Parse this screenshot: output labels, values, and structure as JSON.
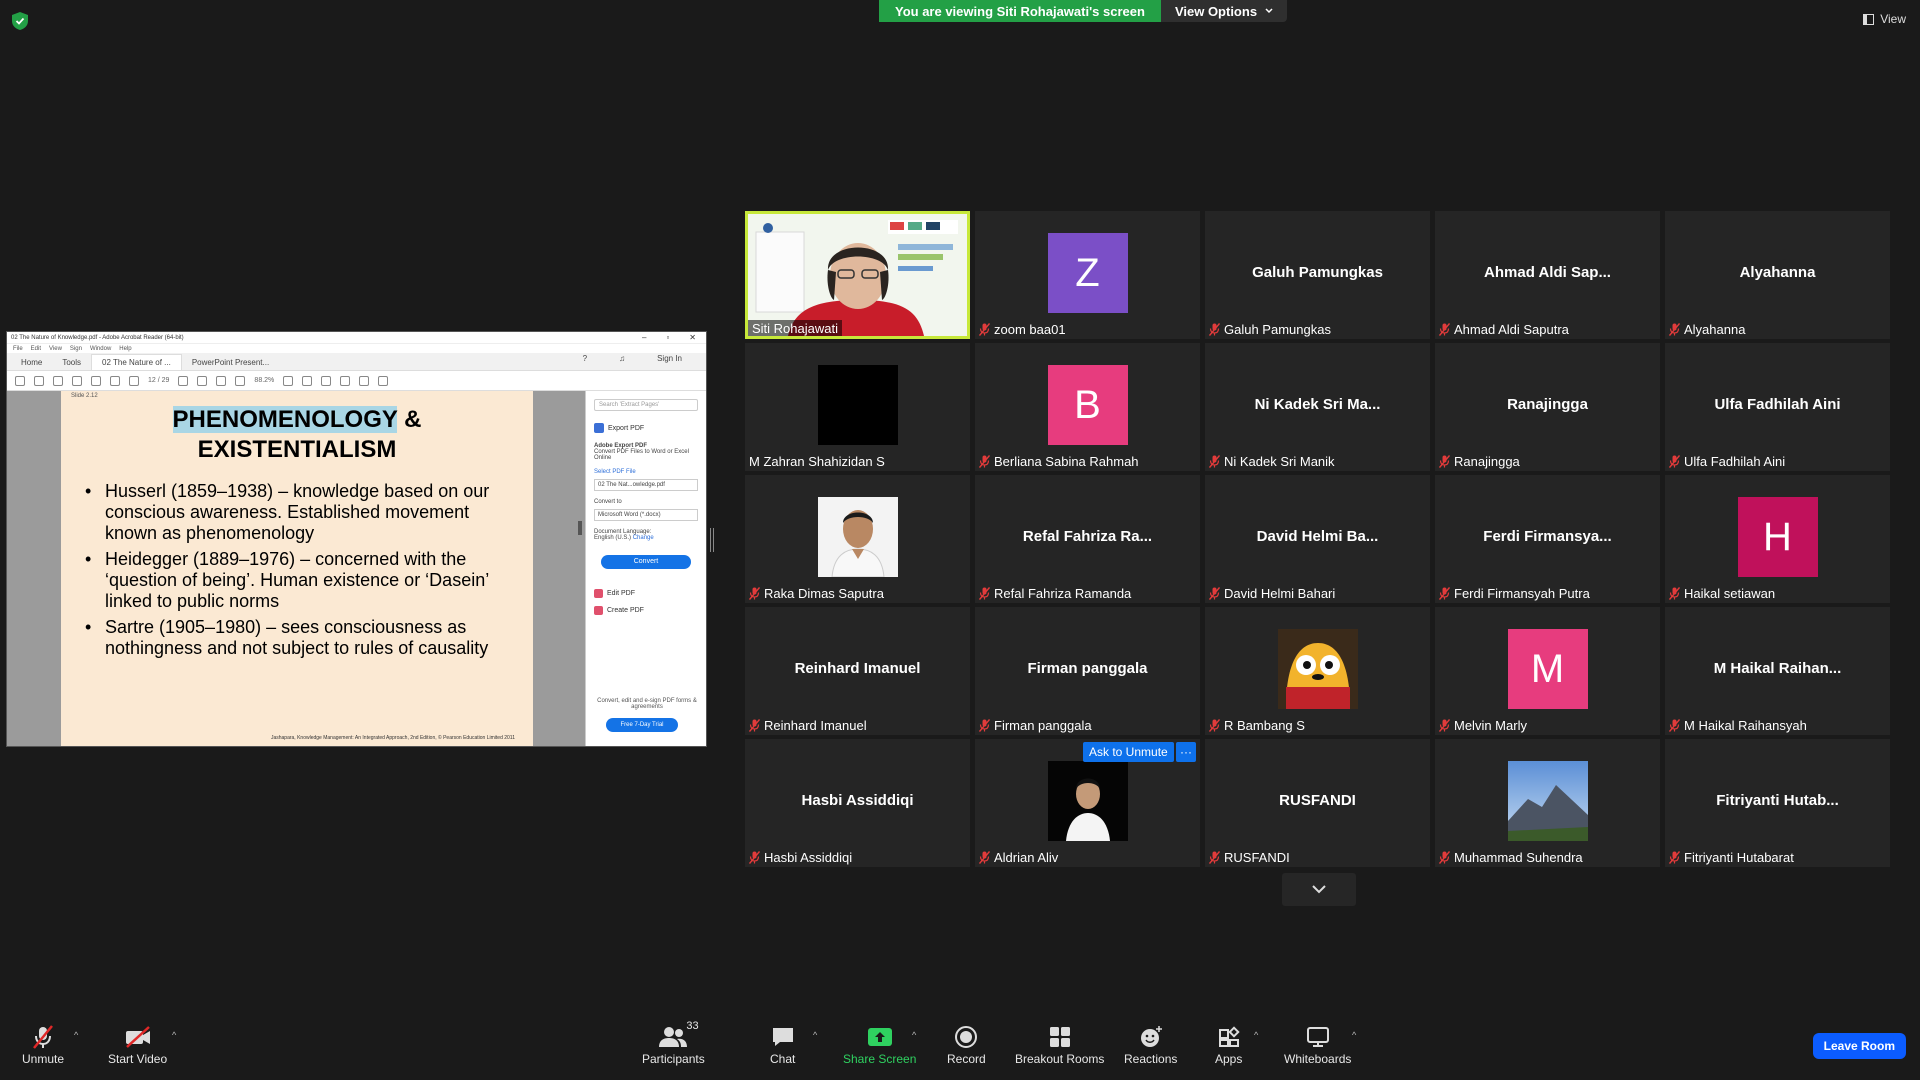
{
  "banner": {
    "viewing_text": "You are viewing Siti Rohajawati's screen",
    "view_options": "View Options",
    "view_label": "View"
  },
  "shared_screen": {
    "window_title": "02 The Nature of Knowledge.pdf - Adobe Acrobat Reader (64-bit)",
    "menu": [
      "File",
      "Edit",
      "View",
      "Sign",
      "Window",
      "Help"
    ],
    "tabs": [
      "Home",
      "Tools",
      "02 The Nature of ...",
      "PowerPoint Present..."
    ],
    "sign_in": "Sign In",
    "page_indicator": "12 / 29",
    "zoom": "88.2%",
    "slide_label": "Slide 2.12",
    "slide_title_highlight": "PHENOMENOLOGY",
    "slide_title_rest": " &",
    "slide_title_line2": "EXISTENTIALISM",
    "bullets": [
      "Husserl (1859–1938) – knowledge based on our conscious awareness. Established movement known as phenomenology",
      "Heidegger (1889–1976) – concerned with the ‘question of being’. Human existence or ‘Dasein’ linked to public norms",
      "Sartre (1905–1980) – sees consciousness as nothingness and not subject to rules of causality"
    ],
    "slide_footer": "Jashapara, Knowledge Management: An Integrated Approach, 2nd Edition, © Pearson Education Limited 2011",
    "panel": {
      "search_placeholder": "Search 'Extract Pages'",
      "export_label": "Export PDF",
      "adobe_export": "Adobe Export PDF",
      "convert_desc": "Convert PDF Files to Word or Excel Online",
      "select_file": "Select PDF File",
      "file_name": "02 The Nat...owledge.pdf",
      "convert_to": "Convert to",
      "convert_format": "Microsoft Word (*.docx)",
      "doc_language": "Document Language:",
      "language": "English (U.S.)",
      "change": "Change",
      "convert_btn": "Convert",
      "edit_pdf": "Edit PDF",
      "create_pdf": "Create PDF",
      "note": "Convert, edit and e-sign PDF forms & agreements",
      "trial_btn": "Free 7-Day Trial"
    }
  },
  "participants_tiles": [
    {
      "big": "",
      "label": "Siti Rohajawati",
      "type": "video-presenter",
      "muted": false,
      "speaking": true
    },
    {
      "big": "Z",
      "label": "zoom baa01",
      "type": "avatar",
      "color": "#7b4fc7",
      "muted": true
    },
    {
      "big": "Galuh Pamungkas",
      "label": "Galuh Pamungkas",
      "type": "name",
      "muted": true
    },
    {
      "big": "Ahmad Aldi Sap...",
      "label": "Ahmad Aldi Saputra",
      "type": "name",
      "muted": true
    },
    {
      "big": "Alyahanna",
      "label": "Alyahanna",
      "type": "name",
      "muted": true
    },
    {
      "big": "",
      "label": "M Zahran Shahizidan S",
      "type": "black",
      "muted": false
    },
    {
      "big": "B",
      "label": "Berliana Sabina Rahmah",
      "type": "avatar",
      "color": "#e73c7e",
      "muted": true
    },
    {
      "big": "Ni Kadek Sri Ma...",
      "label": "Ni Kadek Sri Manik",
      "type": "name",
      "muted": true
    },
    {
      "big": "Ranajingga",
      "label": "Ranajingga",
      "type": "name",
      "muted": true
    },
    {
      "big": "Ulfa Fadhilah Aini",
      "label": "Ulfa Fadhilah Aini",
      "type": "name",
      "muted": true
    },
    {
      "big": "",
      "label": "Raka Dimas Saputra",
      "type": "photo-person",
      "muted": true
    },
    {
      "big": "Refal Fahriza Ra...",
      "label": "Refal Fahriza Ramanda",
      "type": "name",
      "muted": true
    },
    {
      "big": "David Helmi Ba...",
      "label": "David Helmi Bahari",
      "type": "name",
      "muted": true
    },
    {
      "big": "Ferdi Firmansya...",
      "label": "Ferdi Firmansyah Putra",
      "type": "name",
      "muted": true
    },
    {
      "big": "H",
      "label": "Haikal setiawan",
      "type": "avatar",
      "color": "#c0115b",
      "muted": true
    },
    {
      "big": "Reinhard Imanuel",
      "label": "Reinhard Imanuel",
      "type": "name",
      "muted": true
    },
    {
      "big": "Firman panggala",
      "label": "Firman panggala",
      "type": "name",
      "muted": true
    },
    {
      "big": "",
      "label": "R Bambang S",
      "type": "photo-cartoon",
      "muted": true
    },
    {
      "big": "M",
      "label": "Melvin Marly",
      "type": "avatar",
      "color": "#e73c7e",
      "muted": true
    },
    {
      "big": "M Haikal Raihan...",
      "label": "M Haikal Raihansyah",
      "type": "name",
      "muted": true
    },
    {
      "big": "Hasbi Assiddiqi",
      "label": "Hasbi Assiddiqi",
      "type": "name",
      "muted": true
    },
    {
      "big": "",
      "label": "Aldrian Aliv",
      "type": "photo-dark",
      "muted": true
    },
    {
      "big": "RUSFANDI",
      "label": "RUSFANDI",
      "type": "name",
      "muted": true
    },
    {
      "big": "",
      "label": "Muhammad Suhendra",
      "type": "photo-mountain",
      "muted": true
    },
    {
      "big": "Fitriyanti Hutab...",
      "label": "Fitriyanti Hutabarat",
      "type": "name",
      "muted": true
    }
  ],
  "hover": {
    "ask_unmute": "Ask to Unmute",
    "more": "···"
  },
  "toolbar": {
    "unmute": "Unmute",
    "start_video": "Start Video",
    "participants": "Participants",
    "participants_count": "33",
    "chat": "Chat",
    "share_screen": "Share Screen",
    "record": "Record",
    "breakout_rooms": "Breakout Rooms",
    "reactions": "Reactions",
    "apps": "Apps",
    "whiteboards": "Whiteboards",
    "leave_room": "Leave Room"
  }
}
